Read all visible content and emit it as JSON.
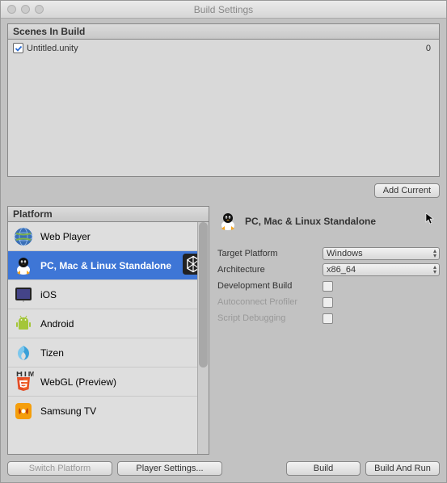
{
  "window": {
    "title": "Build Settings"
  },
  "scenes": {
    "header": "Scenes In Build",
    "items": [
      {
        "checked": true,
        "name": "Untitled.unity",
        "index": "0"
      }
    ],
    "add_button": "Add Current"
  },
  "platform": {
    "header": "Platform",
    "items": [
      {
        "label": "Web Player",
        "icon": "globe"
      },
      {
        "label": "PC, Mac & Linux Standalone",
        "icon": "tux",
        "selected": true,
        "badge": "unity"
      },
      {
        "label": "iOS",
        "icon": "ipad"
      },
      {
        "label": "Android",
        "icon": "android"
      },
      {
        "label": "Tizen",
        "icon": "tizen"
      },
      {
        "label": "WebGL (Preview)",
        "icon": "html5"
      },
      {
        "label": "Samsung TV",
        "icon": "samsung"
      }
    ]
  },
  "detail": {
    "title": "PC, Mac & Linux Standalone",
    "fields": {
      "target_platform": {
        "label": "Target Platform",
        "value": "Windows"
      },
      "architecture": {
        "label": "Architecture",
        "value": "x86_64"
      },
      "dev_build": {
        "label": "Development Build"
      },
      "autoconnect": {
        "label": "Autoconnect Profiler"
      },
      "script_debug": {
        "label": "Script Debugging"
      }
    }
  },
  "buttons": {
    "switch_platform": "Switch Platform",
    "player_settings": "Player Settings...",
    "build": "Build",
    "build_and_run": "Build And Run"
  }
}
